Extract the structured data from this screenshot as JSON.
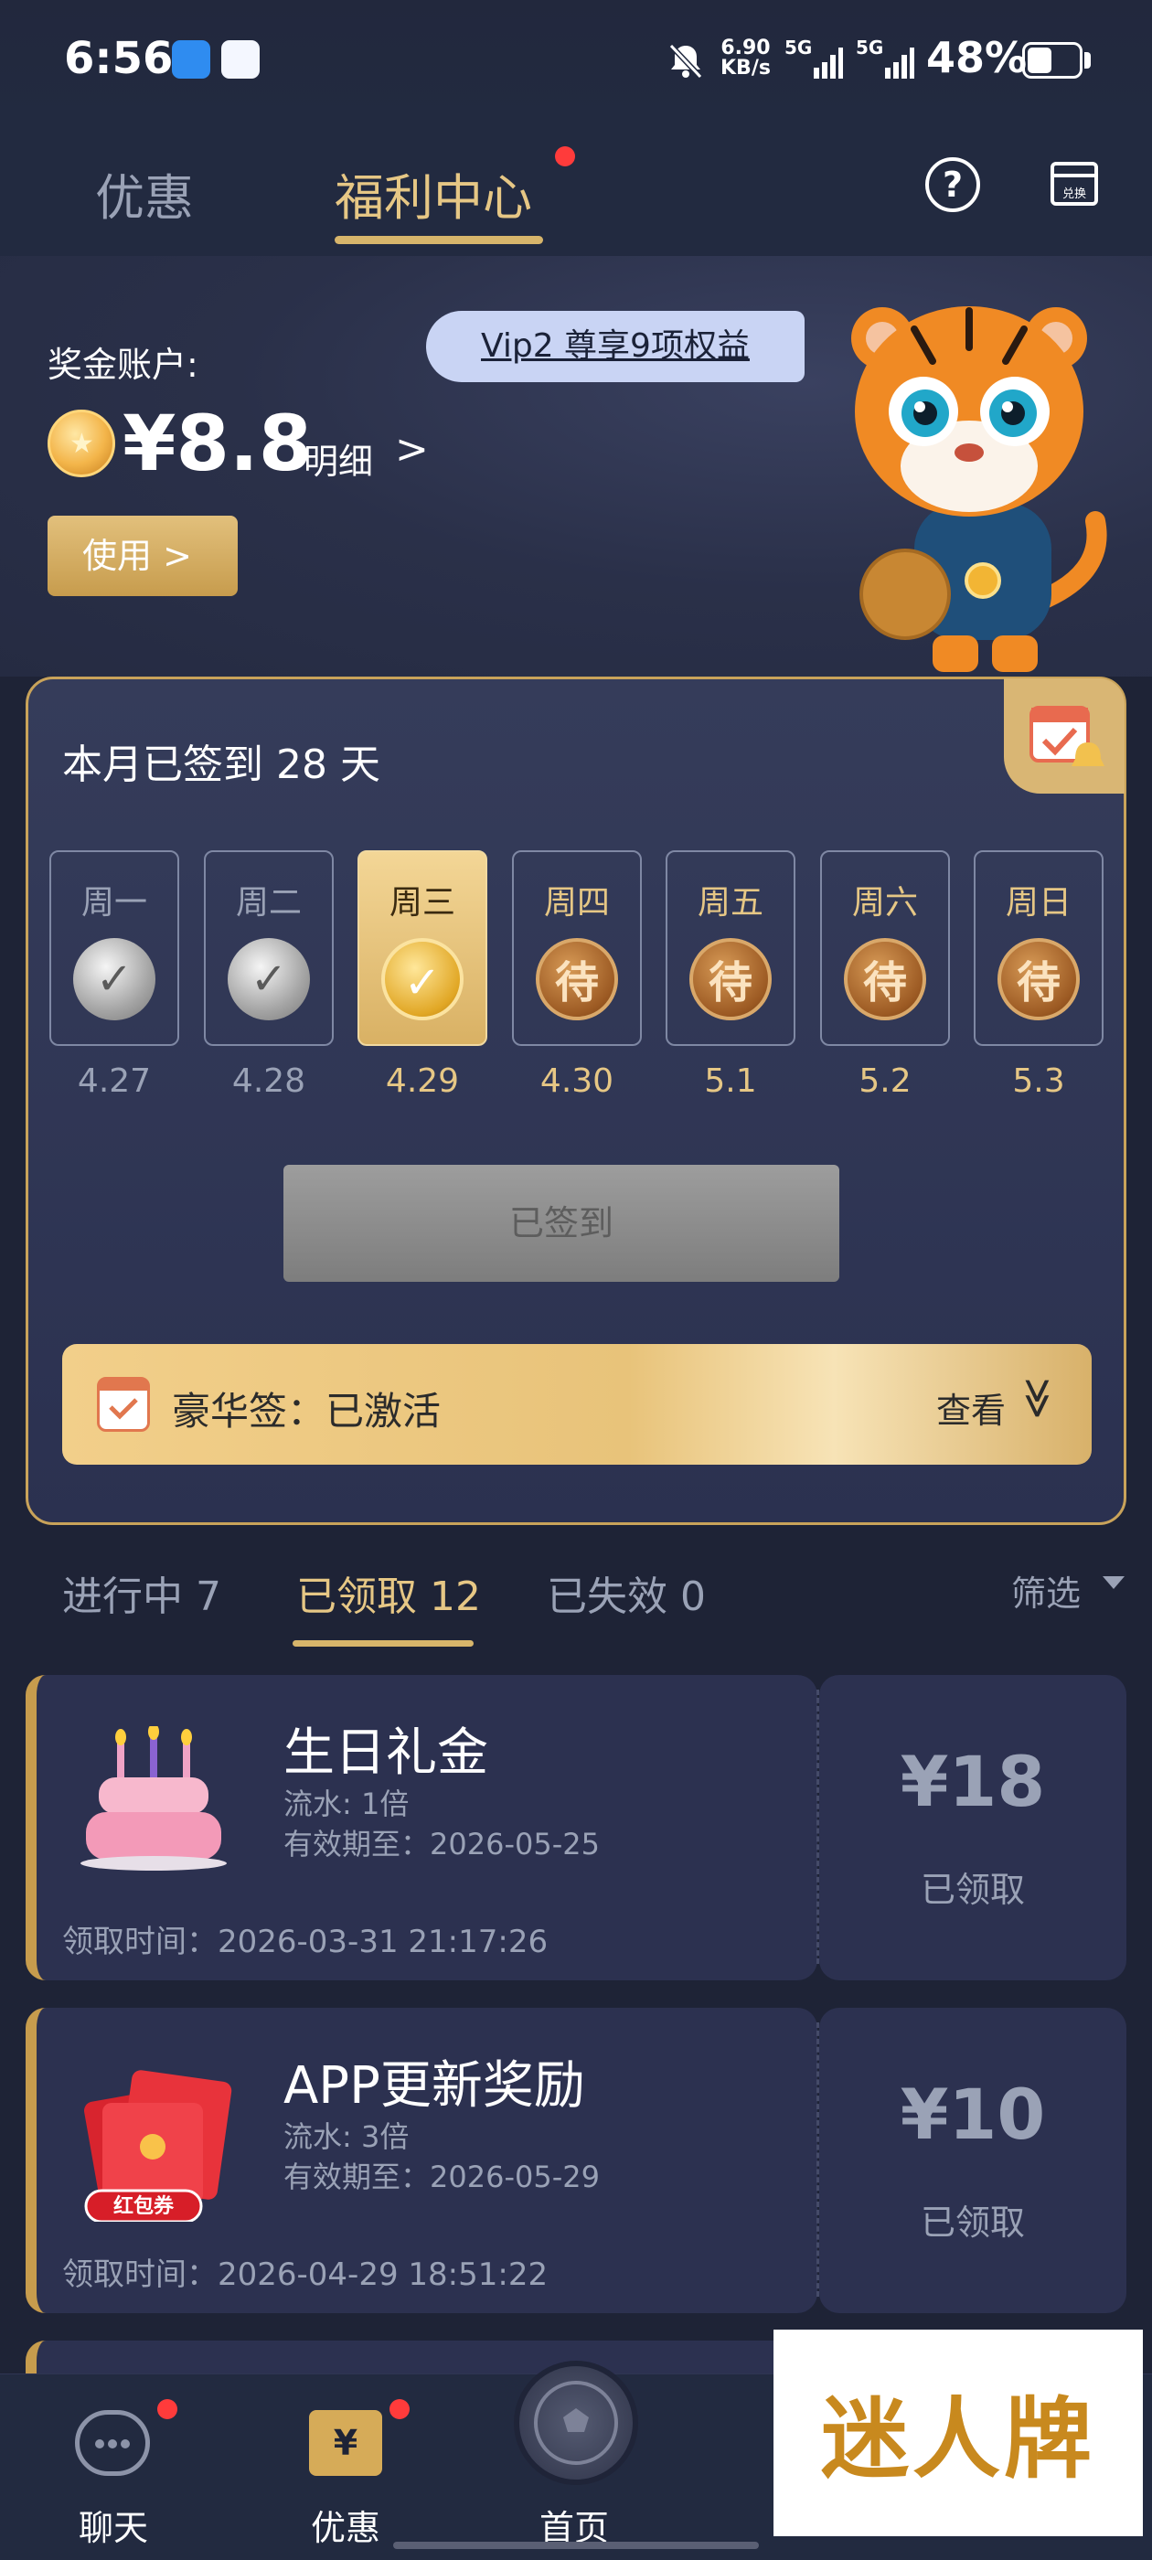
{
  "status_bar": {
    "time": "6:56",
    "net_speed_value": "6.90",
    "net_speed_unit": "KB/s",
    "sim1": "5G",
    "sim2": "5G",
    "battery": "48%"
  },
  "top_tabs": {
    "tab_promo": "优惠",
    "tab_welfare": "福利中心",
    "help_glyph": "?",
    "redeem_label": "兑换"
  },
  "account": {
    "vip_badge": "Vip2 尊享9项权益",
    "label": "奖金账户:",
    "balance": "¥8.8",
    "detail_link": "明细",
    "detail_arrow": ">",
    "use_button": "使用 >"
  },
  "signin": {
    "title": "本月已签到 28 天",
    "days": [
      {
        "name": "周一",
        "date": "4.27",
        "status": "done"
      },
      {
        "name": "周二",
        "date": "4.28",
        "status": "done"
      },
      {
        "name": "周三",
        "date": "4.29",
        "status": "today"
      },
      {
        "name": "周四",
        "date": "4.30",
        "status": "pending"
      },
      {
        "name": "周五",
        "date": "5.1",
        "status": "pending"
      },
      {
        "name": "周六",
        "date": "5.2",
        "status": "pending"
      },
      {
        "name": "周日",
        "date": "5.3",
        "status": "pending"
      }
    ],
    "pending_glyph": "待",
    "done_glyph": "✓",
    "button": "已签到",
    "luxury_text": "豪华签：已激活",
    "luxury_view": "查看",
    "luxury_chevron": "≫"
  },
  "filter_tabs": {
    "in_progress": "进行中 7",
    "received": "已领取 12",
    "expired": "已失效 0",
    "filter": "筛选"
  },
  "rewards": [
    {
      "title": "生日礼金",
      "turnover": "流水: 1倍",
      "valid_until": "有效期至：2026-05-25",
      "received_time": "领取时间：2026-03-31 21:17:26",
      "amount": "¥18",
      "state": "已领取",
      "icon": "birthday-cake-icon"
    },
    {
      "title": "APP更新奖励",
      "turnover": "流水: 3倍",
      "valid_until": "有效期至：2026-05-29",
      "received_time": "领取时间：2026-04-29 18:51:22",
      "amount": "¥10",
      "state": "已领取",
      "icon": "red-envelope-icon",
      "icon_label": "红包券"
    }
  ],
  "bottom_nav": {
    "chat": "聊天",
    "promo": "优惠",
    "home": "首页",
    "promo_icon_glyph": "¥"
  },
  "overlay_watermark": "迷人牌",
  "colors": {
    "background": "#1e2336",
    "gold": "#d7b56b",
    "gold_text": "#e6c785",
    "muted": "#9aa2b6",
    "badge_red": "#ff3b3b"
  }
}
